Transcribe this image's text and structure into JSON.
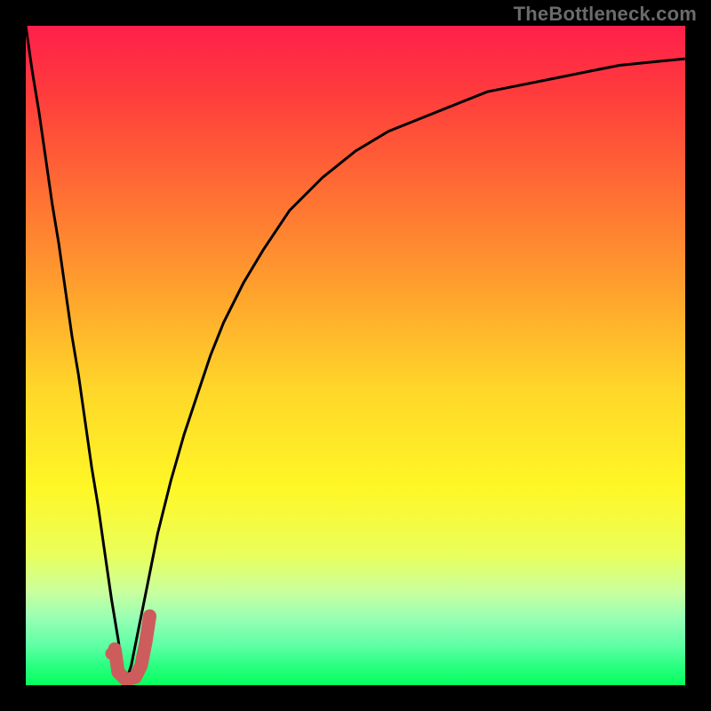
{
  "watermark": "TheBottleneck.com",
  "colors": {
    "page_bg": "#000000",
    "curve_stroke": "#000000",
    "marker_stroke": "#cd5c5c",
    "marker_fill": "#cd5c5c",
    "gradient_top": "#ff1f4a",
    "gradient_bottom": "#06ff5e"
  },
  "chart_data": {
    "type": "line",
    "title": "",
    "xlabel": "",
    "ylabel": "",
    "xlim": [
      0,
      100
    ],
    "ylim": [
      0,
      100
    ],
    "grid": false,
    "legend": false,
    "notes": "V-shaped bottleneck curve; minimum sits near x≈15. A short J-shaped red marker indicates optimal point near the bottom of the V.",
    "x": [
      0,
      1,
      2,
      3,
      4,
      5,
      6,
      7,
      8,
      9,
      10,
      11,
      12,
      13,
      14,
      15,
      16,
      17,
      18,
      19,
      20,
      22,
      24,
      26,
      28,
      30,
      33,
      36,
      40,
      45,
      50,
      55,
      60,
      65,
      70,
      75,
      80,
      85,
      90,
      95,
      100
    ],
    "y": [
      100,
      93,
      87,
      80,
      73,
      67,
      60,
      53,
      47,
      40,
      33,
      27,
      20,
      13,
      7,
      0,
      3,
      8,
      13,
      18,
      23,
      31,
      38,
      44,
      50,
      55,
      61,
      66,
      72,
      77,
      81,
      84,
      86,
      88,
      90,
      91,
      92,
      93,
      94,
      94.5,
      95
    ],
    "marker": {
      "type": "j-shape",
      "x": 15,
      "y": 3,
      "path_points": [
        {
          "x": 13.5,
          "y": 5.5
        },
        {
          "x": 14.0,
          "y": 2.0
        },
        {
          "x": 15.2,
          "y": 0.8
        },
        {
          "x": 16.6,
          "y": 1.2
        },
        {
          "x": 17.5,
          "y": 3.0
        },
        {
          "x": 18.2,
          "y": 6.5
        },
        {
          "x": 18.8,
          "y": 10.5
        }
      ]
    }
  }
}
